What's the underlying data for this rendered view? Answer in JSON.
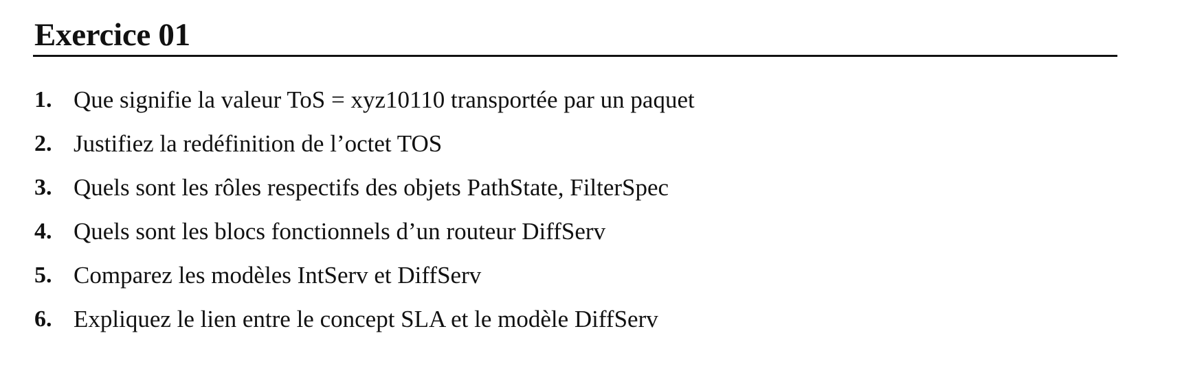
{
  "document": {
    "heading": "Exercice 01",
    "questions": [
      {
        "number": "1.",
        "text": "Que signifie la valeur ToS = xyz10110 transportée par un paquet"
      },
      {
        "number": "2.",
        "text": "Justifiez la redéfinition de l’octet TOS"
      },
      {
        "number": "3.",
        "text": "Quels sont les rôles respectifs des objets PathState, FilterSpec"
      },
      {
        "number": "4.",
        "text": "Quels sont les blocs fonctionnels d’un routeur DiffServ"
      },
      {
        "number": "5.",
        "text": "Comparez les modèles IntServ et DiffServ"
      },
      {
        "number": "6.",
        "text": "Expliquez le lien entre le concept SLA et le modèle DiffServ"
      }
    ]
  }
}
